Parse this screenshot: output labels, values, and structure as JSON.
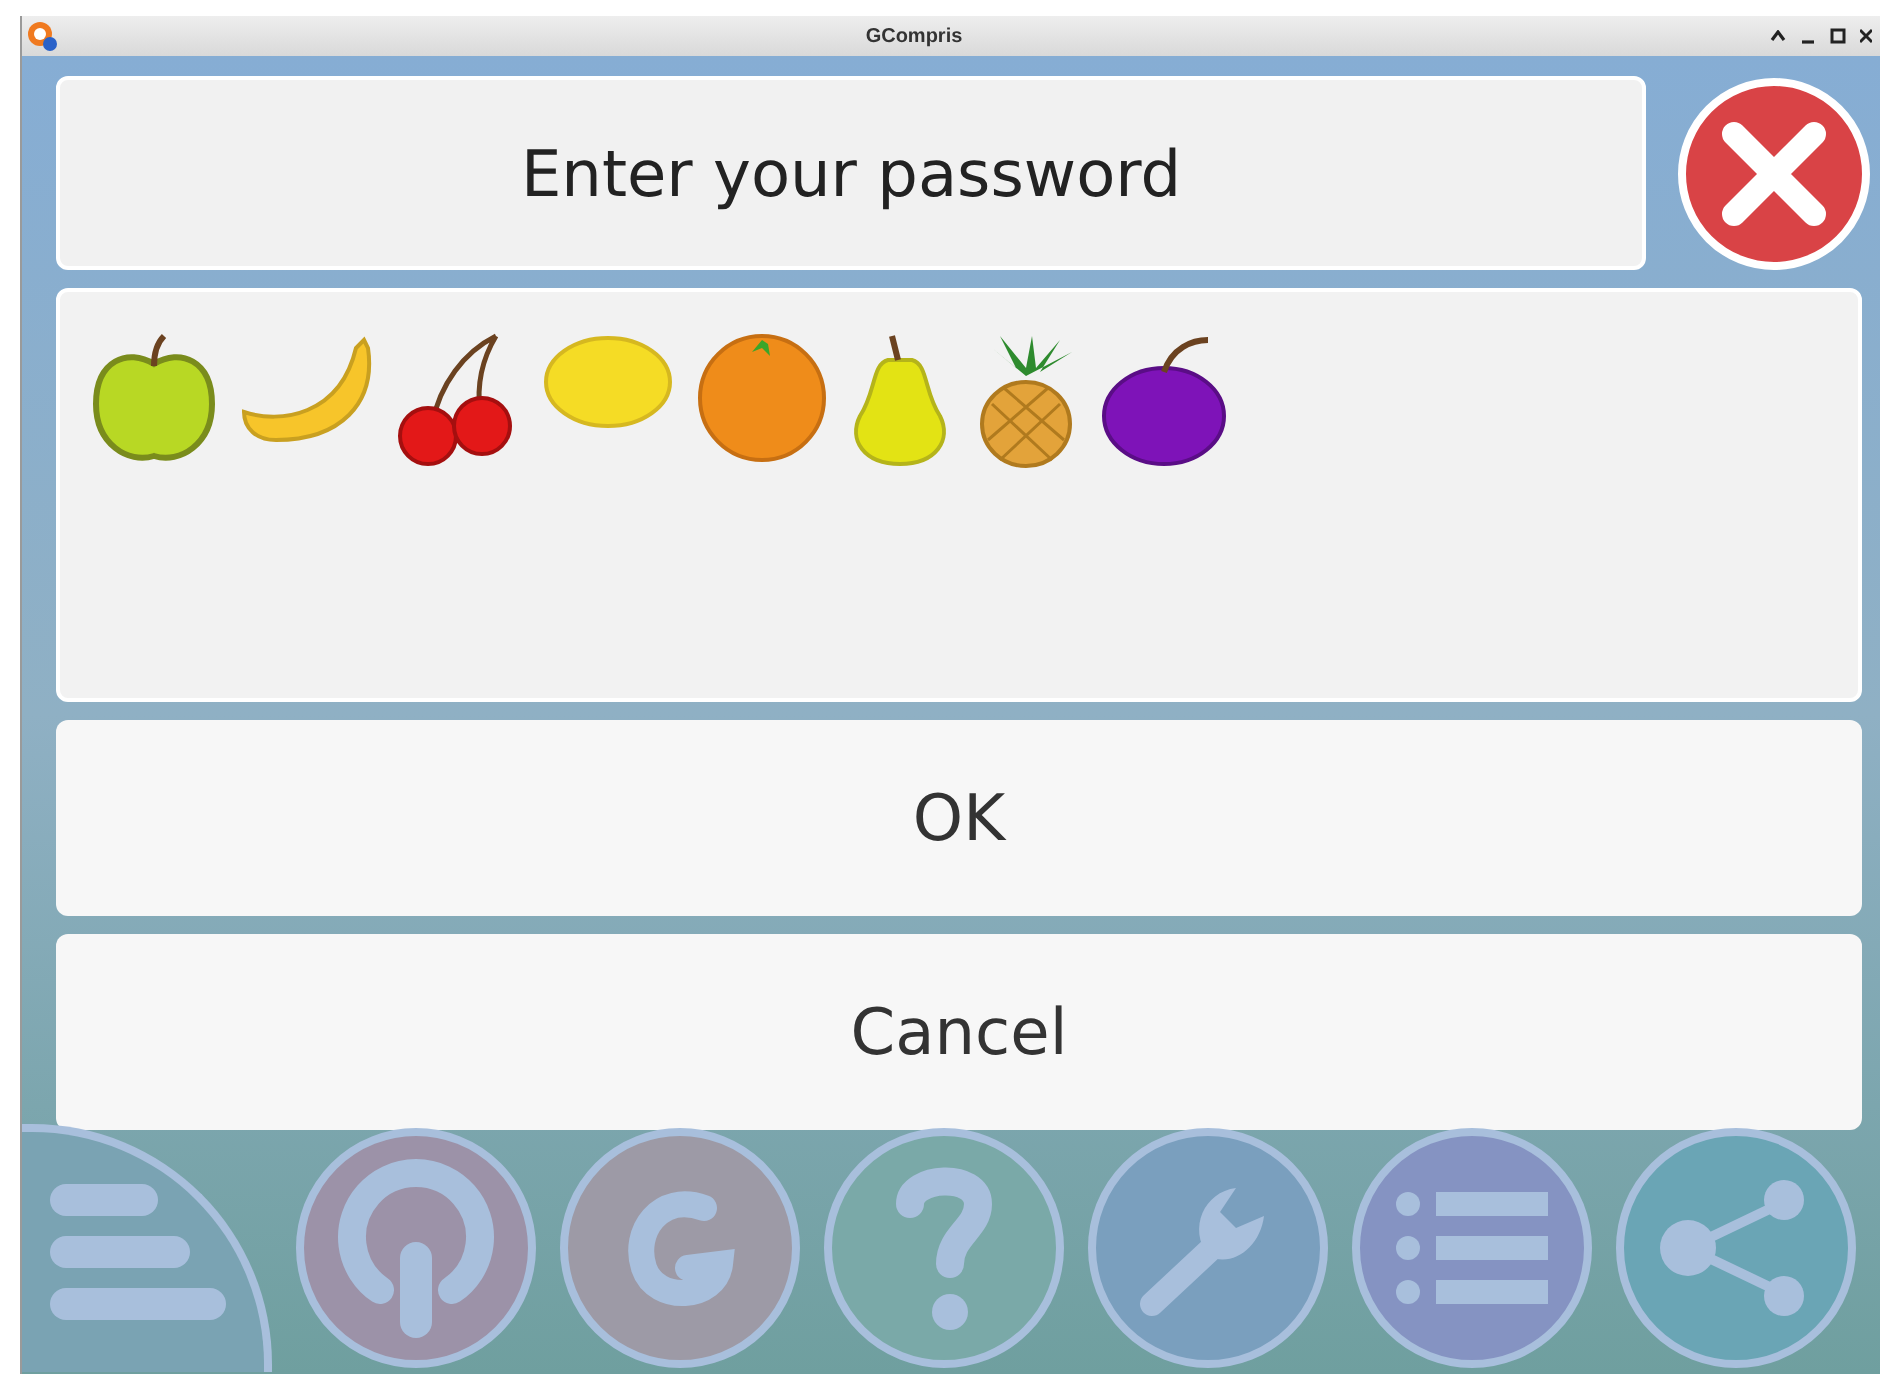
{
  "window": {
    "title": "GCompris"
  },
  "prompt": "Enter your password",
  "buttons": [
    {
      "label": "OK"
    },
    {
      "label": "Cancel"
    }
  ]
}
